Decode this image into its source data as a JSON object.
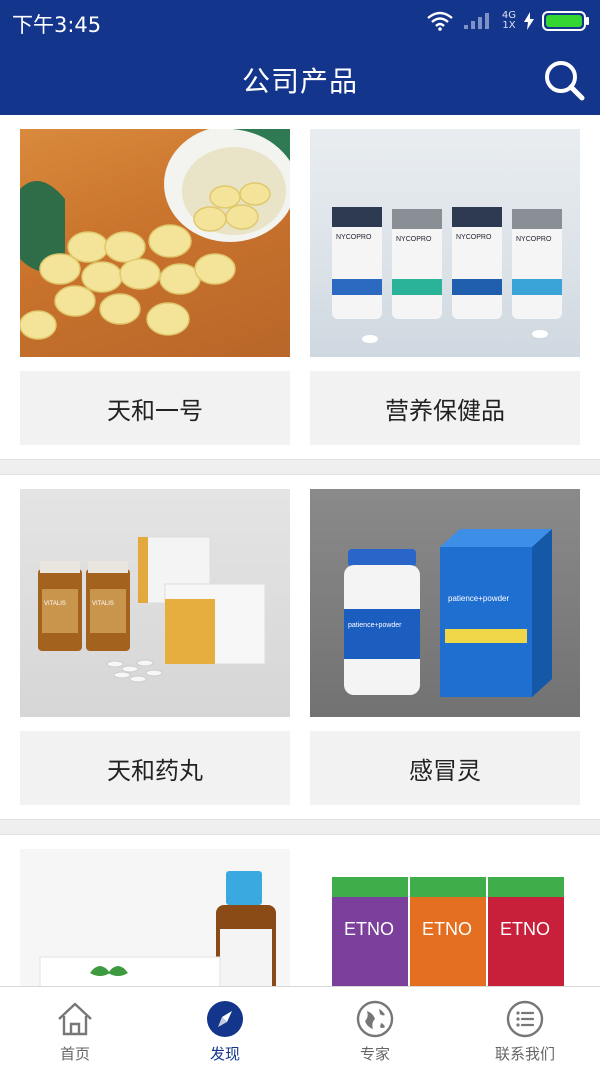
{
  "status": {
    "time": "下午3:45",
    "network_top": "4G",
    "network_bottom": "1X"
  },
  "header": {
    "title": "公司产品"
  },
  "products": [
    {
      "label": "天和一号"
    },
    {
      "label": "营养保健品"
    },
    {
      "label": "天和药丸"
    },
    {
      "label": "感冒灵"
    },
    {
      "label": ""
    },
    {
      "label": ""
    }
  ],
  "product_images": [
    {
      "brand_texts": []
    },
    {
      "brand_texts": [
        "NYCOPRO",
        "NYCOPRO",
        "NYCOPRO",
        "NYCOPRO"
      ]
    },
    {
      "brand_texts": [
        "VITALIS",
        "VITALIS"
      ]
    },
    {
      "brand_texts": [
        "patience+powder",
        "patience+powder"
      ]
    },
    {
      "brand_texts": []
    },
    {
      "brand_texts": [
        "ETNO",
        "ETNO",
        "ETNO"
      ]
    }
  ],
  "tabbar": {
    "items": [
      {
        "label": "首页",
        "icon": "home-icon"
      },
      {
        "label": "发现",
        "icon": "compass-icon"
      },
      {
        "label": "专家",
        "icon": "globe-icon"
      },
      {
        "label": "联系我们",
        "icon": "list-icon"
      }
    ],
    "active_index": 1
  },
  "colors": {
    "primary": "#14358c",
    "tab_active": "#14358c",
    "label_bg": "#f2f2f2"
  }
}
